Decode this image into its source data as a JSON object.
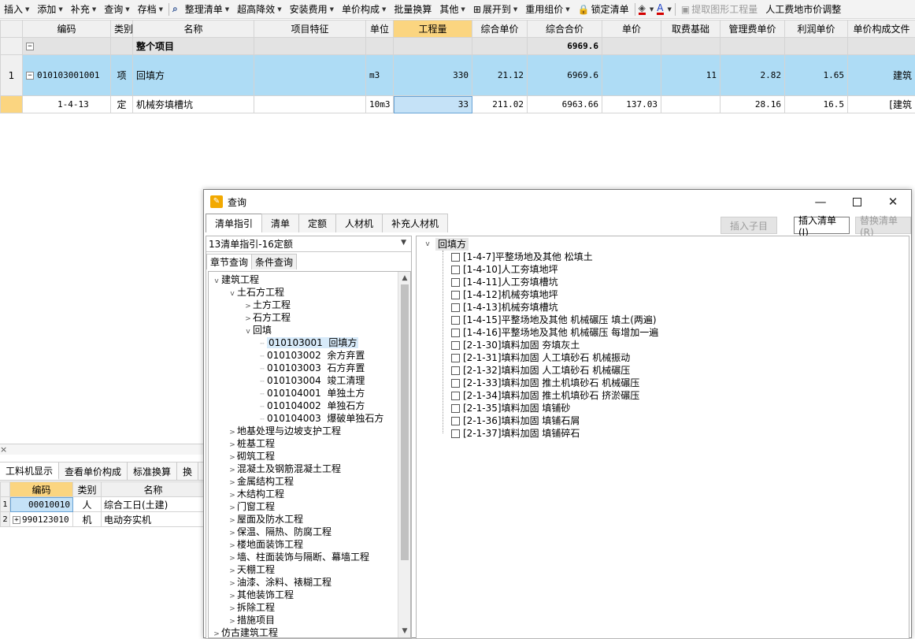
{
  "toolbar": {
    "items": [
      {
        "label": "插入",
        "dd": true
      },
      {
        "label": "添加",
        "dd": true
      },
      {
        "label": "补充",
        "dd": true
      },
      {
        "label": "查询",
        "dd": true
      },
      {
        "label": "存档",
        "dd": true
      },
      {
        "label": "",
        "icon": "binoculars-icon"
      },
      {
        "label": "整理清单",
        "dd": true
      },
      {
        "label": "超高降效",
        "dd": true
      },
      {
        "label": "安装费用",
        "dd": true
      },
      {
        "label": "单价构成",
        "dd": true
      },
      {
        "label": "批量换算",
        "dd": false
      },
      {
        "label": "其他",
        "dd": true
      },
      {
        "label": "展开到",
        "dd": true,
        "icon": "expand-tree-icon"
      },
      {
        "label": "重用组价",
        "dd": true
      },
      {
        "label": "锁定清单",
        "dd": false,
        "icon": "lock-icon"
      },
      {
        "label": "",
        "dd": true,
        "icon": "fill-color-icon"
      },
      {
        "label": "",
        "dd": true,
        "icon": "font-color-icon"
      },
      {
        "label": "提取图形工程量",
        "dd": false,
        "disabled": true,
        "icon": "extract-icon"
      },
      {
        "label": "人工费地市价调整",
        "dd": false
      }
    ]
  },
  "grid": {
    "headers": [
      "",
      "编码",
      "类别",
      "名称",
      "项目特征",
      "单位",
      "工程量",
      "综合单价",
      "综合合价",
      "单价",
      "取费基础",
      "管理费单价",
      "利润单价",
      "单价构成文件"
    ],
    "summary": {
      "name": "整个项目",
      "total": "6969.6"
    },
    "rows": [
      {
        "idx": "1",
        "code": "010103001001",
        "type": "项",
        "name": "回填方",
        "feature": "",
        "unit": "m3",
        "qty": "330",
        "price": "21.12",
        "total": "6969.6",
        "unit_price": "",
        "base": "11",
        "mgmt": "2.82",
        "profit": "1.65",
        "file": "建筑"
      },
      {
        "idx": "",
        "code": "1-4-13",
        "type": "定",
        "name": "机械夯填槽坑",
        "feature": "",
        "unit": "10m3",
        "qty": "33",
        "price": "211.02",
        "total": "6963.66",
        "unit_price": "137.03",
        "base": "",
        "mgmt": "28.16",
        "profit": "16.5",
        "file": "[建筑"
      }
    ]
  },
  "lower": {
    "tabs": [
      "工料机显示",
      "查看单价构成",
      "标准换算",
      "换"
    ],
    "headers": [
      "",
      "编码",
      "类别",
      "名称"
    ],
    "rows": [
      {
        "idx": "1",
        "code": "00010010",
        "type": "人",
        "name": "综合工日(土建)"
      },
      {
        "idx": "2",
        "code": "990123010",
        "type": "机",
        "name": "电动夯实机"
      }
    ]
  },
  "dialog": {
    "title": "查询",
    "tabs": [
      "清单指引",
      "清单",
      "定额",
      "人材机",
      "补充人材机"
    ],
    "buttons": {
      "insert_child": "插入子目",
      "insert_list": "插入清单(I)",
      "replace_list": "替换清单(R)"
    },
    "combo": "13清单指引-16定额",
    "subtabs": [
      "章节查询",
      "条件查询"
    ],
    "tree": [
      {
        "t": "建筑工程",
        "lv": 0,
        "tog": "v"
      },
      {
        "t": "土石方工程",
        "lv": 1,
        "tog": "v"
      },
      {
        "t": "土方工程",
        "lv": 2,
        "tog": ">"
      },
      {
        "t": "石方工程",
        "lv": 2,
        "tog": ">"
      },
      {
        "t": "回填",
        "lv": 2,
        "tog": "v"
      },
      {
        "t": "010103001  回填方",
        "lv": 3,
        "sel": true
      },
      {
        "t": "010103002  余方弃置",
        "lv": 3
      },
      {
        "t": "010103003  石方弃置",
        "lv": 3
      },
      {
        "t": "010103004  竣工清理",
        "lv": 3
      },
      {
        "t": "010104001  单独土方",
        "lv": 3
      },
      {
        "t": "010104002  单独石方",
        "lv": 3
      },
      {
        "t": "010104003  爆破单独石方",
        "lv": 3
      },
      {
        "t": "地基处理与边坡支护工程",
        "lv": 1,
        "tog": ">"
      },
      {
        "t": "桩基工程",
        "lv": 1,
        "tog": ">"
      },
      {
        "t": "砌筑工程",
        "lv": 1,
        "tog": ">"
      },
      {
        "t": "混凝土及钢筋混凝土工程",
        "lv": 1,
        "tog": ">"
      },
      {
        "t": "金属结构工程",
        "lv": 1,
        "tog": ">"
      },
      {
        "t": "木结构工程",
        "lv": 1,
        "tog": ">"
      },
      {
        "t": "门窗工程",
        "lv": 1,
        "tog": ">"
      },
      {
        "t": "屋面及防水工程",
        "lv": 1,
        "tog": ">"
      },
      {
        "t": "保温、隔热、防腐工程",
        "lv": 1,
        "tog": ">"
      },
      {
        "t": "楼地面装饰工程",
        "lv": 1,
        "tog": ">"
      },
      {
        "t": "墙、柱面装饰与隔断、幕墙工程",
        "lv": 1,
        "tog": ">"
      },
      {
        "t": "天棚工程",
        "lv": 1,
        "tog": ">"
      },
      {
        "t": "油漆、涂料、裱糊工程",
        "lv": 1,
        "tog": ">"
      },
      {
        "t": "其他装饰工程",
        "lv": 1,
        "tog": ">"
      },
      {
        "t": "拆除工程",
        "lv": 1,
        "tog": ">"
      },
      {
        "t": "措施项目",
        "lv": 1,
        "tog": ">"
      },
      {
        "t": "仿古建筑工程",
        "lv": 0,
        "tog": ">"
      }
    ],
    "right_root": "回填方",
    "right_items": [
      "[1-4-7]平整场地及其他 松填土",
      "[1-4-10]人工夯填地坪",
      "[1-4-11]人工夯填槽坑",
      "[1-4-12]机械夯填地坪",
      "[1-4-13]机械夯填槽坑",
      "[1-4-15]平整场地及其他 机械碾压 填土(两遍)",
      "[1-4-16]平整场地及其他 机械碾压 每增加一遍",
      "[2-1-30]填料加固 夯填灰土",
      "[2-1-31]填料加固 人工填砂石 机械振动",
      "[2-1-32]填料加固 人工填砂石 机械碾压",
      "[2-1-33]填料加固 推土机填砂石 机械碾压",
      "[2-1-34]填料加固 推土机填砂石 挤淤碾压",
      "[2-1-35]填料加固 填铺砂",
      "[2-1-36]填料加固 填铺石屑",
      "[2-1-37]填料加固 填铺碎石"
    ]
  }
}
